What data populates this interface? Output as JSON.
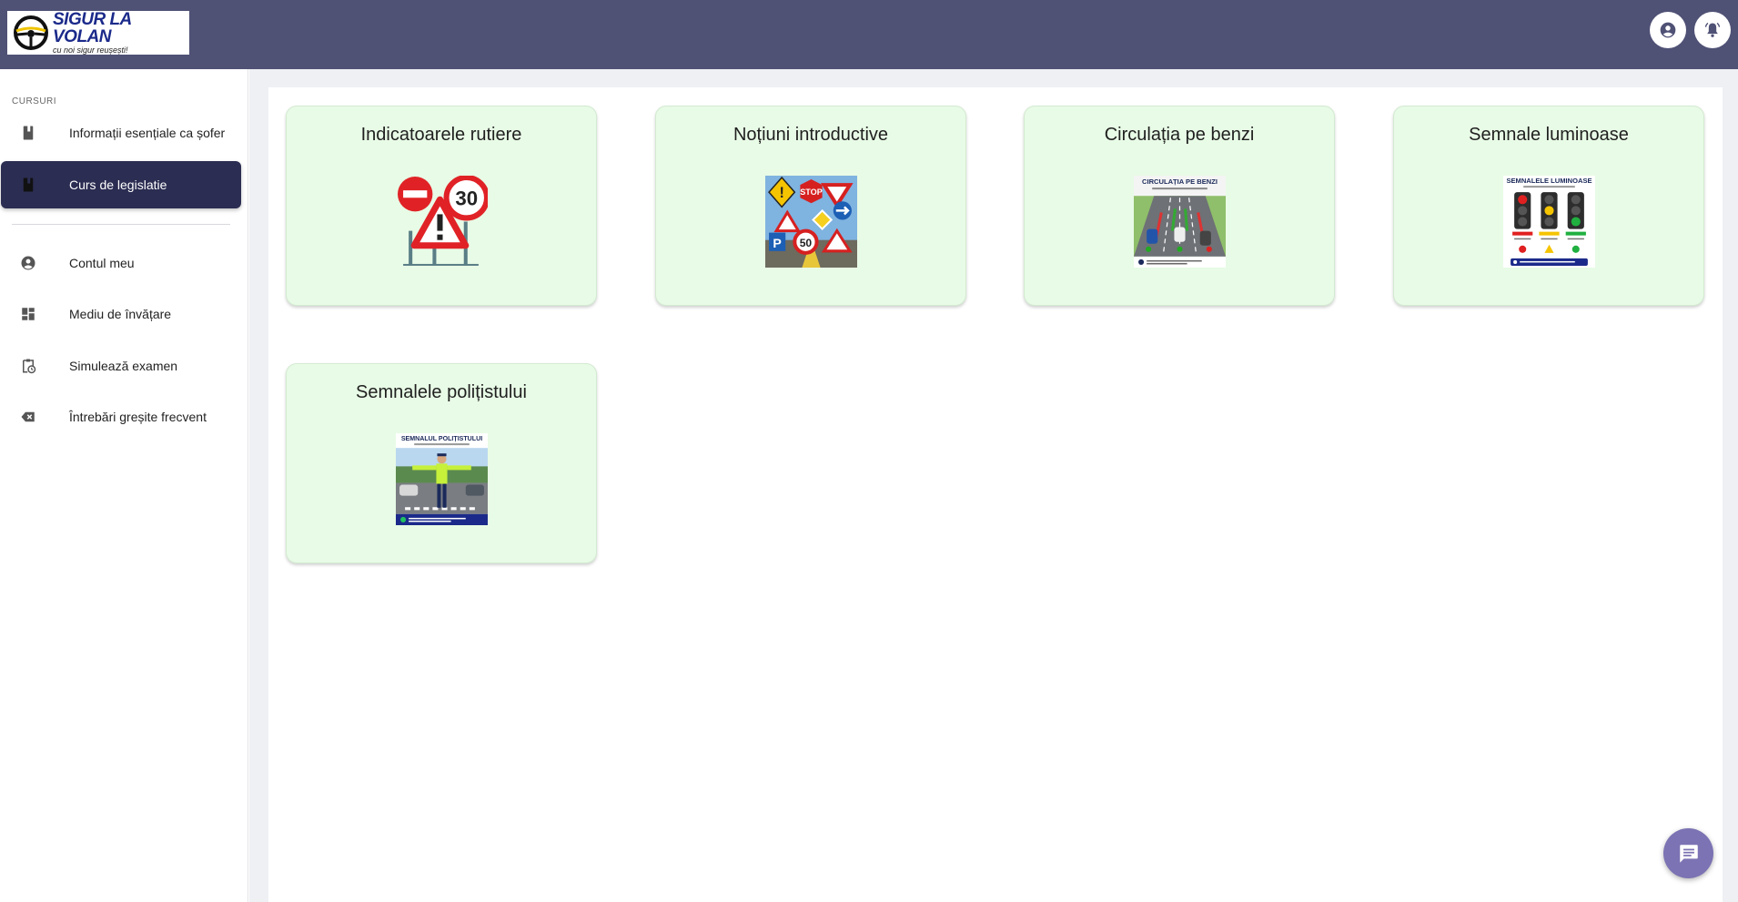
{
  "header": {
    "brand": "SIGUR LA VOLAN",
    "tagline": "cu noi sigur reușești!"
  },
  "sidebar": {
    "section_label": "CURSURI",
    "items": [
      {
        "label": "Informații esențiale ca șofer",
        "icon": "book-icon"
      },
      {
        "label": "Curs de legislatie",
        "icon": "book-icon",
        "active": true
      },
      {
        "label": "Contul meu",
        "icon": "account-circle-icon"
      },
      {
        "label": "Mediu de învățare",
        "icon": "dashboard-icon"
      },
      {
        "label": "Simulează examen",
        "icon": "clipboard-clock-icon"
      },
      {
        "label": "Întrebări greșite frecvent",
        "icon": "backspace-icon"
      }
    ]
  },
  "courses": [
    {
      "title": "Indicatoarele rutiere",
      "image": "road-signs-illustration"
    },
    {
      "title": "Noțiuni introductive",
      "image": "traffic-signs-collage"
    },
    {
      "title": "Circulația pe benzi",
      "image": "lane-traffic-poster",
      "poster_title": "CIRCULAȚIA PE BENZI"
    },
    {
      "title": "Semnale luminoase",
      "image": "traffic-lights-poster",
      "poster_title": "SEMNALELE LUMINOASE"
    },
    {
      "title": "Semnalele polițistului",
      "image": "police-officer-poster",
      "poster_title": "SEMNALUL POLIȚISTULUI"
    }
  ],
  "colors": {
    "topbar": "#4f5175",
    "active_nav": "#2b2d52",
    "card_bg": "#e8fbe6",
    "chat_button": "#7b73b3"
  }
}
